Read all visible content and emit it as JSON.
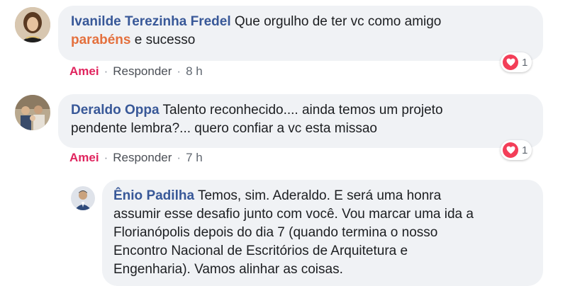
{
  "comments": [
    {
      "author": "Ivanilde Terezinha Fredel",
      "text_before": " Que orgulho de ter vc como amigo",
      "highlight": "parabéns",
      "text_after": " e sucesso",
      "like_label": "Amei",
      "reply_label": "Responder",
      "time": "8 h",
      "reaction_count": "1",
      "reaction_icon": "heart-icon",
      "reaction_color": "#f33e58"
    },
    {
      "author": "Deraldo Oppa",
      "text_line1": " Talento reconhecido.... ainda temos um projeto",
      "text_line2": "pendente lembra?... quero confiar a vc esta missao",
      "like_label": "Amei",
      "reply_label": "Responder",
      "time": "7 h",
      "reaction_count": "1",
      "reaction_icon": "heart-icon",
      "reaction_color": "#f33e58"
    }
  ],
  "reply": {
    "author": "Ênio Padilha",
    "line1": " Temos, sim. Aderaldo. E será uma honra",
    "line2": "assumir esse desafio junto com você. Vou marcar uma ida a",
    "line3": "Florianópolis depois do dia 7 (quando termina o nosso",
    "line4": "Encontro Nacional de Escritórios de Arquitetura e",
    "line5": "Engenharia). Vamos alinhar as coisas."
  },
  "separator": "·",
  "colors": {
    "author": "#385898",
    "love": "#e0245e",
    "highlight": "#e4703d",
    "bubble": "#f0f2f5"
  }
}
